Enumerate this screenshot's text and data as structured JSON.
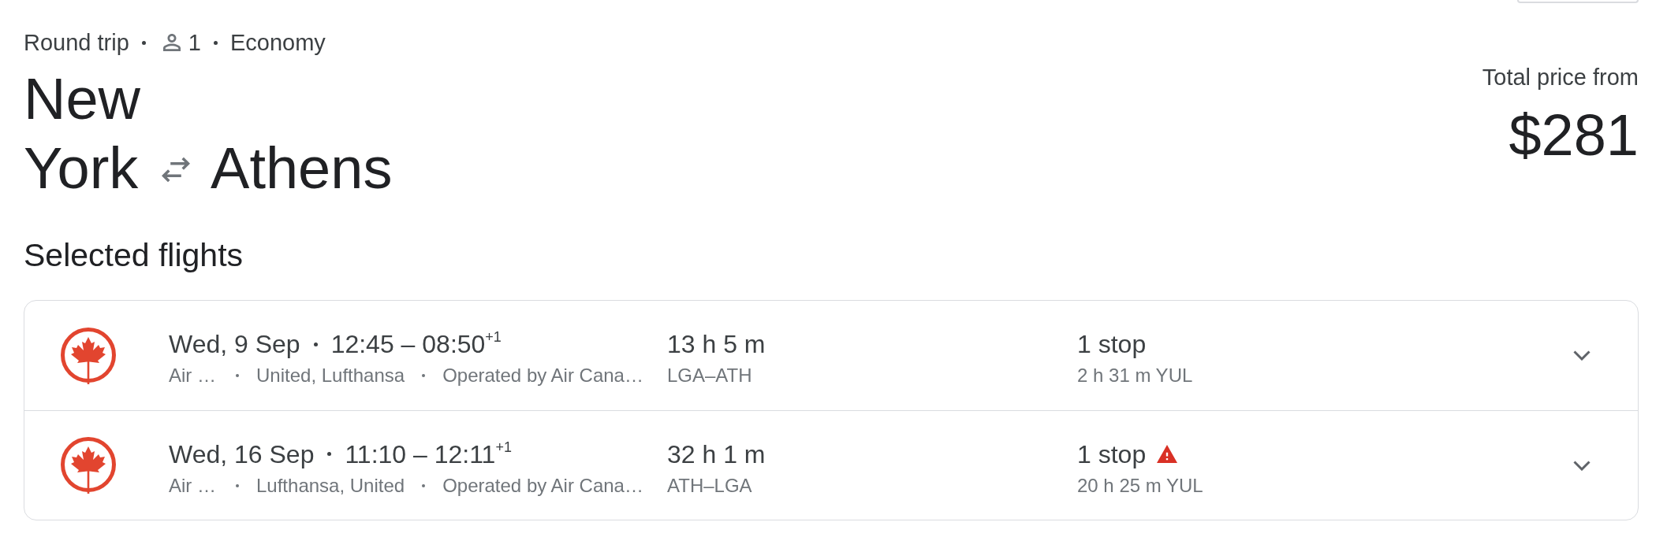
{
  "trip": {
    "type": "Round trip",
    "passengers": "1",
    "cabin": "Economy"
  },
  "route": {
    "origin": "New York",
    "destination": "Athens"
  },
  "price": {
    "label": "Total price from",
    "amount": "$281"
  },
  "selected_flights": {
    "heading": "Selected flights",
    "flights": [
      {
        "date": "Wed, 9 Sep",
        "times": "12:45 – 08:50$^{+1}$",
        "airline": "Air …",
        "partners": "United, Lufthansa",
        "operator": "Operated by Air Cana…",
        "duration": "13 h 5 m",
        "route": "LGA–ATH",
        "stops": "1 stop",
        "warning": false,
        "layover": "2 h 31 m YUL",
        "expanded": false
      },
      {
        "date": "Wed, 16 Sep",
        "times": "11:10 – 12:11$^{+1}$",
        "airline": "Air …",
        "partners": "Lufthansa, United",
        "operator": "Operated by Air Cana…",
        "duration": "32 h 1 m",
        "route": "ATH–LGA",
        "stops": "1 stop",
        "warning": true,
        "layover": "20 h 25 m YUL",
        "expanded": false
      }
    ]
  }
}
